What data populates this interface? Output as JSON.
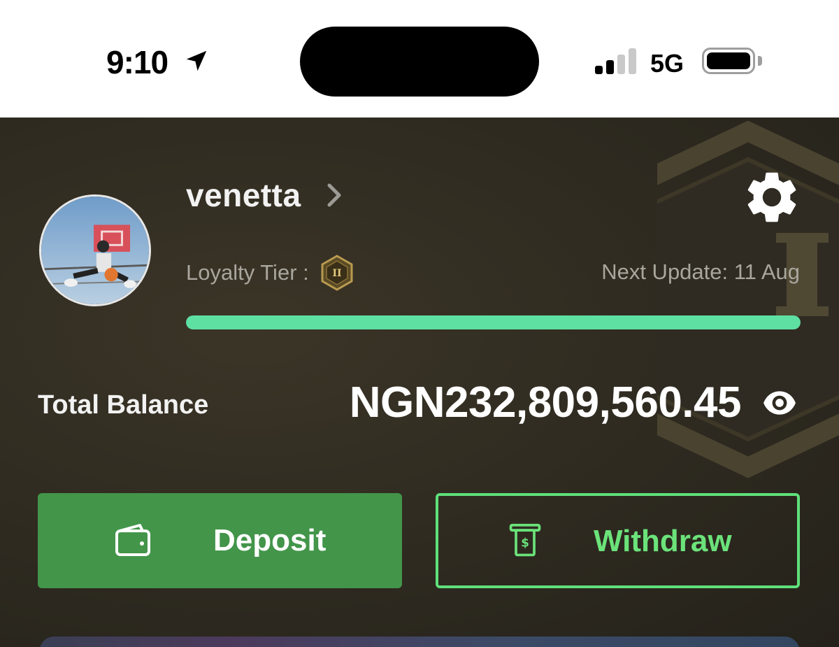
{
  "status_bar": {
    "time": "9:10",
    "network": "5G",
    "location_icon": "location-arrow-icon",
    "signal_icon": "cellular-signal-icon",
    "battery_icon": "battery-full-icon"
  },
  "profile": {
    "username": "venetta",
    "avatar": "profile-photo",
    "loyalty_tier_label": "Loyalty Tier :",
    "tier_badge_text": "II",
    "next_update": "Next Update: 11 Aug",
    "tier_progress": 1.0
  },
  "balance": {
    "label": "Total Balance",
    "amount": "NGN232,809,560.45"
  },
  "actions": {
    "deposit_label": "Deposit",
    "withdraw_label": "Withdraw"
  },
  "colors": {
    "background": "#2e2a20",
    "accent_green": "#43954a",
    "progress_green": "#5fe0a3",
    "withdraw_green": "#5fe07a"
  }
}
